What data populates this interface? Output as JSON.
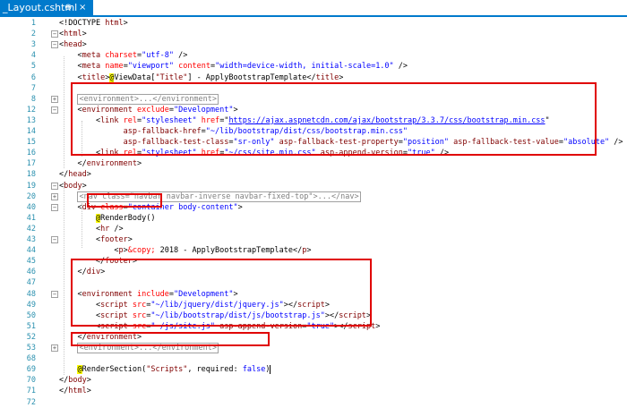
{
  "tab": {
    "title": "_Layout.cshtml",
    "pin_glyph": "⊕",
    "close_glyph": "×"
  },
  "lines": [
    {
      "n": "1",
      "tokens": [
        [
          "x",
          "<!DOCTYPE "
        ],
        [
          "t",
          "html"
        ],
        [
          "x",
          ">"
        ]
      ]
    },
    {
      "n": "2",
      "fold": "−",
      "tokens": [
        [
          "x",
          "<"
        ],
        [
          "t",
          "html"
        ],
        [
          "x",
          ">"
        ]
      ]
    },
    {
      "n": "3",
      "fold": "−",
      "tokens": [
        [
          "x",
          "<"
        ],
        [
          "t",
          "head"
        ],
        [
          "x",
          ">"
        ]
      ]
    },
    {
      "n": "4",
      "tokens": [
        [
          "x",
          "    <"
        ],
        [
          "t",
          "meta"
        ],
        [
          "x",
          " "
        ],
        [
          "a",
          "charset"
        ],
        [
          "x",
          "="
        ],
        [
          "v",
          "\"utf-8\""
        ],
        [
          "x",
          " />"
        ]
      ]
    },
    {
      "n": "5",
      "tokens": [
        [
          "x",
          "    <"
        ],
        [
          "t",
          "meta"
        ],
        [
          "x",
          " "
        ],
        [
          "a",
          "name"
        ],
        [
          "x",
          "="
        ],
        [
          "v",
          "\"viewport\""
        ],
        [
          "x",
          " "
        ],
        [
          "a",
          "content"
        ],
        [
          "x",
          "="
        ],
        [
          "v",
          "\"width=device-width, initial-scale=1.0\""
        ],
        [
          "x",
          " />"
        ]
      ]
    },
    {
      "n": "6",
      "tokens": [
        [
          "x",
          "    <"
        ],
        [
          "t",
          "title"
        ],
        [
          "x",
          ">"
        ],
        [
          "razor",
          "@"
        ],
        [
          "x",
          "ViewData["
        ],
        [
          "t",
          "\"Title\""
        ],
        [
          "x",
          "] - ApplyBootstrapTemplate</"
        ],
        [
          "t",
          "title"
        ],
        [
          "x",
          ">"
        ]
      ]
    },
    {
      "n": "7",
      "tokens": []
    },
    {
      "n": "8",
      "fold": "+",
      "tokens": [
        [
          "x",
          "    "
        ],
        [
          "collapsed",
          "<environment>...</environment>"
        ]
      ]
    },
    {
      "n": "12",
      "fold": "−",
      "tokens": [
        [
          "x",
          "    <"
        ],
        [
          "t",
          "environment"
        ],
        [
          "x",
          " "
        ],
        [
          "a",
          "exclude"
        ],
        [
          "x",
          "="
        ],
        [
          "v",
          "\"Development\""
        ],
        [
          "x",
          ">"
        ]
      ]
    },
    {
      "n": "13",
      "tokens": [
        [
          "x",
          "        <"
        ],
        [
          "t",
          "link"
        ],
        [
          "x",
          " "
        ],
        [
          "a",
          "rel"
        ],
        [
          "x",
          "="
        ],
        [
          "v",
          "\"stylesheet\""
        ],
        [
          "x",
          " "
        ],
        [
          "a",
          "href"
        ],
        [
          "x",
          "=\""
        ],
        [
          "u",
          "https://ajax.aspnetcdn.com/ajax/bootstrap/3.3.7/css/bootstrap.min.css"
        ],
        [
          "x",
          "\""
        ]
      ]
    },
    {
      "n": "14",
      "tokens": [
        [
          "x",
          "              "
        ],
        [
          "t",
          "asp-fallback-href"
        ],
        [
          "x",
          "="
        ],
        [
          "v",
          "\"~/lib/bootstrap/dist/css/bootstrap.min.css\""
        ]
      ]
    },
    {
      "n": "15",
      "tokens": [
        [
          "x",
          "              "
        ],
        [
          "t",
          "asp-fallback-test-class"
        ],
        [
          "x",
          "="
        ],
        [
          "v",
          "\"sr-only\""
        ],
        [
          "x",
          " "
        ],
        [
          "t",
          "asp-fallback-test-property"
        ],
        [
          "x",
          "="
        ],
        [
          "v",
          "\"position\""
        ],
        [
          "x",
          " "
        ],
        [
          "t",
          "asp-fallback-test-value"
        ],
        [
          "x",
          "="
        ],
        [
          "v",
          "\"absolute\""
        ],
        [
          "x",
          " />"
        ]
      ]
    },
    {
      "n": "16",
      "tokens": [
        [
          "x",
          "        <"
        ],
        [
          "t",
          "link"
        ],
        [
          "x",
          " "
        ],
        [
          "a",
          "rel"
        ],
        [
          "x",
          "="
        ],
        [
          "v",
          "\"stylesheet\""
        ],
        [
          "x",
          " "
        ],
        [
          "a",
          "href"
        ],
        [
          "x",
          "="
        ],
        [
          "v",
          "\"~/css/site.min.css\""
        ],
        [
          "x",
          " "
        ],
        [
          "t",
          "asp-append-version"
        ],
        [
          "x",
          "="
        ],
        [
          "v",
          "\"true\""
        ],
        [
          "x",
          " />"
        ]
      ]
    },
    {
      "n": "17",
      "tokens": [
        [
          "x",
          "    </"
        ],
        [
          "t",
          "environment"
        ],
        [
          "x",
          ">"
        ]
      ]
    },
    {
      "n": "18",
      "tokens": [
        [
          "x",
          "</"
        ],
        [
          "t",
          "head"
        ],
        [
          "x",
          ">"
        ]
      ]
    },
    {
      "n": "19",
      "fold": "−",
      "tokens": [
        [
          "x",
          "<"
        ],
        [
          "t",
          "body"
        ],
        [
          "x",
          ">"
        ]
      ]
    },
    {
      "n": "20",
      "fold": "+",
      "tokens": [
        [
          "x",
          "    "
        ],
        [
          "collapsed",
          "<nav class=\"navbar navbar-inverse navbar-fixed-top\">...</nav>"
        ]
      ]
    },
    {
      "n": "40",
      "fold": "−",
      "tokens": [
        [
          "x",
          "    <"
        ],
        [
          "t",
          "div"
        ],
        [
          "x",
          " "
        ],
        [
          "a",
          "class"
        ],
        [
          "x",
          "="
        ],
        [
          "v",
          "\"container body-content\""
        ],
        [
          "x",
          ">"
        ]
      ]
    },
    {
      "n": "41",
      "tokens": [
        [
          "x",
          "        "
        ],
        [
          "razor",
          "@"
        ],
        [
          "x",
          "RenderBody()"
        ]
      ]
    },
    {
      "n": "42",
      "tokens": [
        [
          "x",
          "        <"
        ],
        [
          "t",
          "hr"
        ],
        [
          "x",
          " />"
        ]
      ]
    },
    {
      "n": "43",
      "fold": "−",
      "tokens": [
        [
          "x",
          "        <"
        ],
        [
          "t",
          "footer"
        ],
        [
          "x",
          ">"
        ]
      ]
    },
    {
      "n": "44",
      "tokens": [
        [
          "x",
          "            <"
        ],
        [
          "t",
          "p"
        ],
        [
          "x",
          ">"
        ],
        [
          "a",
          "&copy;"
        ],
        [
          "x",
          " 2018 - ApplyBootstrapTemplate</"
        ],
        [
          "t",
          "p"
        ],
        [
          "x",
          ">"
        ]
      ]
    },
    {
      "n": "45",
      "tokens": [
        [
          "x",
          "        </"
        ],
        [
          "t",
          "footer"
        ],
        [
          "x",
          ">"
        ]
      ]
    },
    {
      "n": "46",
      "tokens": [
        [
          "x",
          "    </"
        ],
        [
          "t",
          "div"
        ],
        [
          "x",
          ">"
        ]
      ]
    },
    {
      "n": "47",
      "tokens": []
    },
    {
      "n": "48",
      "fold": "−",
      "tokens": [
        [
          "x",
          "    <"
        ],
        [
          "t",
          "environment"
        ],
        [
          "x",
          " "
        ],
        [
          "a",
          "include"
        ],
        [
          "x",
          "="
        ],
        [
          "v",
          "\"Development\""
        ],
        [
          "x",
          ">"
        ]
      ]
    },
    {
      "n": "49",
      "tokens": [
        [
          "x",
          "        <"
        ],
        [
          "t",
          "script"
        ],
        [
          "x",
          " "
        ],
        [
          "a",
          "src"
        ],
        [
          "x",
          "="
        ],
        [
          "v",
          "\"~/lib/jquery/dist/jquery.js\""
        ],
        [
          "x",
          "></"
        ],
        [
          "t",
          "script"
        ],
        [
          "x",
          ">"
        ]
      ]
    },
    {
      "n": "50",
      "tokens": [
        [
          "x",
          "        <"
        ],
        [
          "t",
          "script"
        ],
        [
          "x",
          " "
        ],
        [
          "a",
          "src"
        ],
        [
          "x",
          "="
        ],
        [
          "v",
          "\"~/lib/bootstrap/dist/js/bootstrap.js\""
        ],
        [
          "x",
          "></"
        ],
        [
          "t",
          "script"
        ],
        [
          "x",
          ">"
        ]
      ]
    },
    {
      "n": "51",
      "tokens": [
        [
          "x",
          "        <"
        ],
        [
          "t",
          "script"
        ],
        [
          "x",
          " "
        ],
        [
          "a",
          "src"
        ],
        [
          "x",
          "="
        ],
        [
          "v",
          "\"~/js/site.js\""
        ],
        [
          "x",
          " "
        ],
        [
          "t",
          "asp-append-version"
        ],
        [
          "x",
          "="
        ],
        [
          "v",
          "\"true\""
        ],
        [
          "x",
          "></"
        ],
        [
          "t",
          "script"
        ],
        [
          "x",
          ">"
        ]
      ]
    },
    {
      "n": "52",
      "tokens": [
        [
          "x",
          "    </"
        ],
        [
          "t",
          "environment"
        ],
        [
          "x",
          ">"
        ]
      ]
    },
    {
      "n": "53",
      "fold": "+",
      "tokens": [
        [
          "x",
          "    "
        ],
        [
          "collapsed",
          "<environment>...</environment>"
        ]
      ]
    },
    {
      "n": "68",
      "tokens": []
    },
    {
      "n": "69",
      "tokens": [
        [
          "x",
          "    "
        ],
        [
          "razor",
          "@"
        ],
        [
          "x",
          "RenderSection("
        ],
        [
          "t",
          "\"Scripts\""
        ],
        [
          "x",
          ", required: "
        ],
        [
          "k",
          "false"
        ],
        [
          "x",
          ")"
        ],
        [
          "caret",
          ""
        ]
      ]
    },
    {
      "n": "70",
      "tokens": [
        [
          "x",
          "</"
        ],
        [
          "t",
          "body"
        ],
        [
          "x",
          ">"
        ]
      ]
    },
    {
      "n": "71",
      "tokens": [
        [
          "x",
          "</"
        ],
        [
          "t",
          "html"
        ],
        [
          "x",
          ">"
        ]
      ]
    },
    {
      "n": "72",
      "tokens": []
    }
  ]
}
